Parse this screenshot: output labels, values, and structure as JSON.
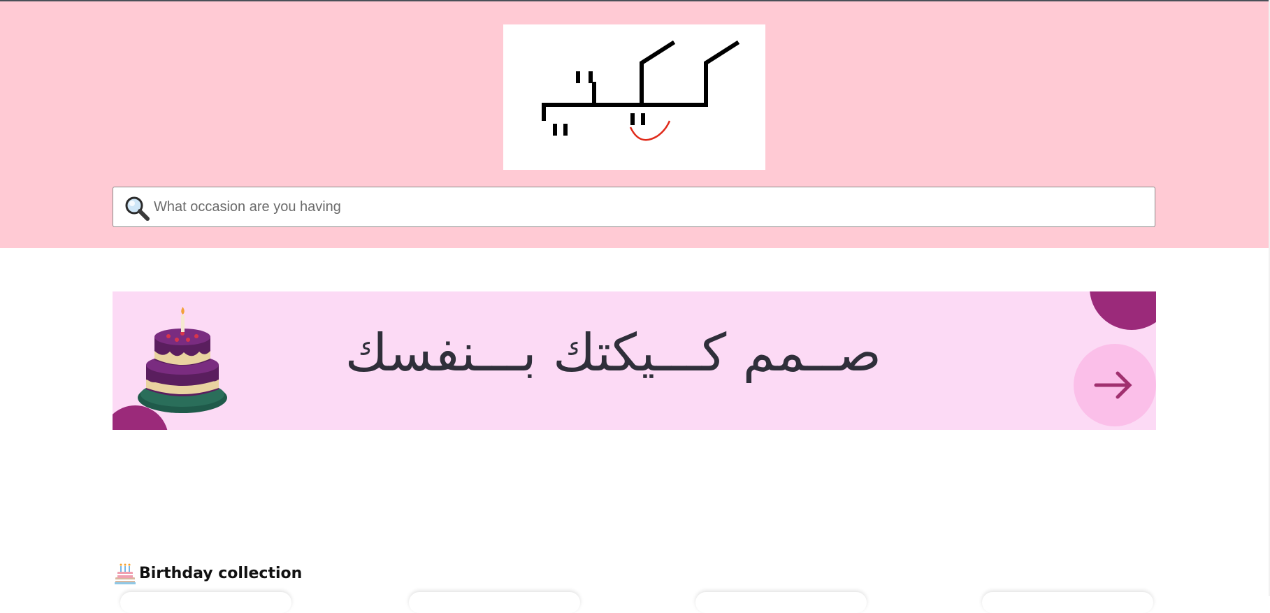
{
  "header": {
    "logo_text": "كيكتي",
    "background_color": "#ffcad4"
  },
  "search": {
    "placeholder": "What occasion are you having",
    "icon": "search-icon"
  },
  "banner": {
    "text": "صــمم كـــيكتك بـــنفسك",
    "background_color": "#fcdaf5",
    "accent_color": "#9b2a7a",
    "icon": "cake-icon",
    "arrow_icon": "arrow-right-icon"
  },
  "collections": [
    {
      "title": "Birthday collection",
      "icon": "birthday-cake-icon"
    }
  ]
}
